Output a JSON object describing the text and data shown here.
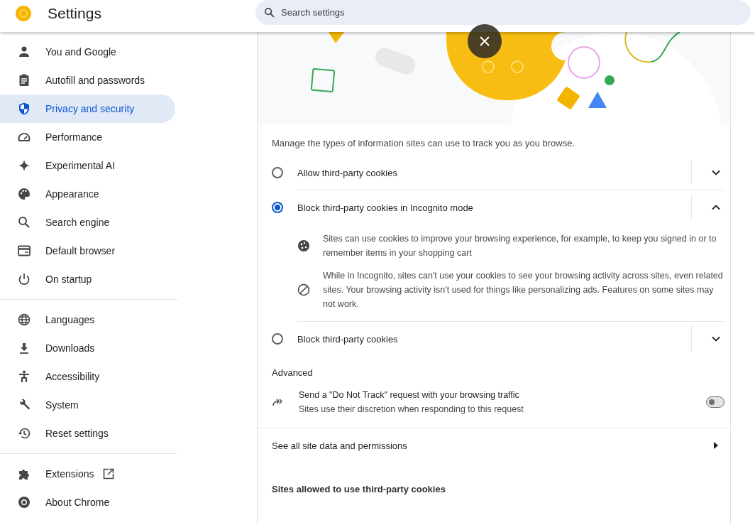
{
  "header": {
    "title": "Settings",
    "search": {
      "placeholder": "Search settings"
    }
  },
  "sidebar": {
    "groups": [
      [
        {
          "label": "You and Google",
          "selected": false
        },
        {
          "label": "Autofill and passwords",
          "selected": false
        },
        {
          "label": "Privacy and security",
          "selected": true
        },
        {
          "label": "Performance",
          "selected": false
        },
        {
          "label": "Experimental AI",
          "selected": false
        },
        {
          "label": "Appearance",
          "selected": false
        },
        {
          "label": "Search engine",
          "selected": false
        },
        {
          "label": "Default browser",
          "selected": false
        },
        {
          "label": "On startup",
          "selected": false
        }
      ],
      [
        {
          "label": "Languages",
          "selected": false
        },
        {
          "label": "Downloads",
          "selected": false
        },
        {
          "label": "Accessibility",
          "selected": false
        },
        {
          "label": "System",
          "selected": false
        },
        {
          "label": "Reset settings",
          "selected": false
        }
      ],
      [
        {
          "label": "Extensions",
          "selected": false
        },
        {
          "label": "About Chrome",
          "selected": false
        }
      ]
    ]
  },
  "content": {
    "description": "Manage the types of information sites can use to track you as you browse.",
    "options": [
      {
        "label": "Allow third-party cookies",
        "selected": false,
        "expanded": false
      },
      {
        "label": "Block third-party cookies in Incognito mode",
        "selected": true,
        "expanded": true,
        "details": [
          "Sites can use cookies to improve your browsing experience, for example, to keep you signed in or to remember items in your shopping cart",
          "While in Incognito, sites can't use your cookies to see your browsing activity across sites, even related sites. Your browsing activity isn't used for things like personalizing ads. Features on some sites may not work."
        ]
      },
      {
        "label": "Block third-party cookies",
        "selected": false,
        "expanded": false
      }
    ],
    "advanced": {
      "heading": "Advanced",
      "title": "Send a \"Do Not Track\" request with your browsing traffic",
      "subtitle": "Sites use their discretion when responding to this request",
      "on": false
    },
    "link_row": "See all site data and permissions",
    "section_heading": "Sites allowed to use third-party cookies"
  }
}
